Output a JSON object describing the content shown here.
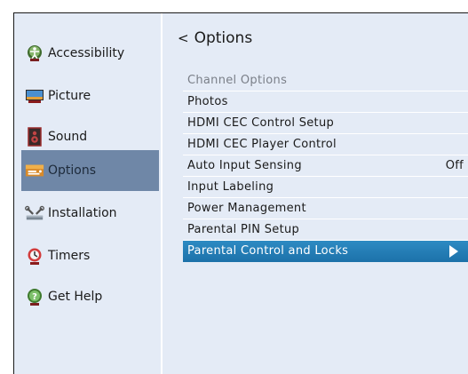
{
  "sidebar": {
    "items": [
      {
        "label": "Accessibility",
        "icon": "accessibility-icon"
      },
      {
        "label": "Picture",
        "icon": "picture-icon"
      },
      {
        "label": "Sound",
        "icon": "sound-icon"
      },
      {
        "label": "Options",
        "icon": "options-icon",
        "active": true
      },
      {
        "label": "Installation",
        "icon": "installation-icon"
      },
      {
        "label": "Timers",
        "icon": "timers-icon"
      },
      {
        "label": "Get Help",
        "icon": "help-icon"
      }
    ]
  },
  "header": {
    "back_glyph": "<",
    "title": "Options"
  },
  "menu": {
    "items": [
      {
        "label": "Channel Options",
        "disabled": true
      },
      {
        "label": "Photos"
      },
      {
        "label": "HDMI CEC Control Setup"
      },
      {
        "label": "HDMI CEC Player Control"
      },
      {
        "label": "Auto Input Sensing",
        "value": "Off"
      },
      {
        "label": "Input Labeling"
      },
      {
        "label": "Power Management"
      },
      {
        "label": "Parental PIN Setup"
      },
      {
        "label": "Parental Control and Locks",
        "selected": true
      }
    ]
  },
  "colors": {
    "panel_bg": "#e4ebf6",
    "active_sidebar": "#6f87a7",
    "selection": "#2d8bc3"
  }
}
